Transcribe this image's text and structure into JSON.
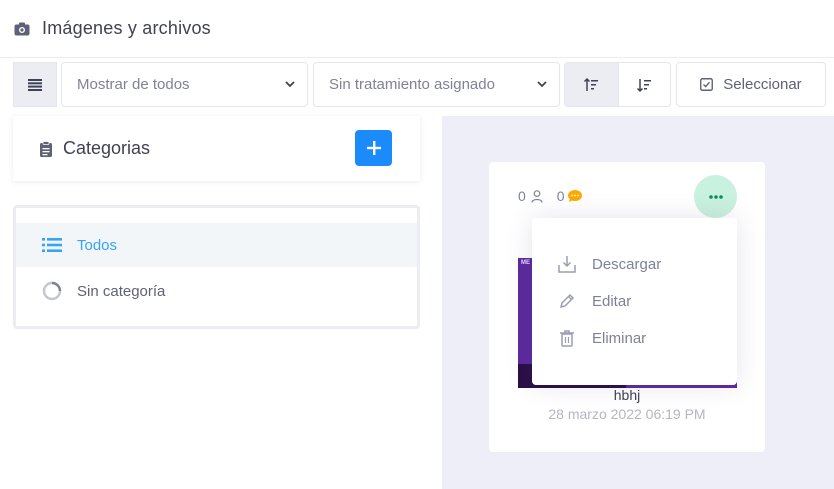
{
  "header": {
    "title": "Imágenes y archivos",
    "icon": "camera-icon"
  },
  "toolbar": {
    "filter_select": "Mostrar de todos",
    "treatment_select": "Sin tratamiento asignado",
    "select_label": "Seleccionar"
  },
  "categories": {
    "title": "Categorias",
    "items": [
      {
        "label": "Todos",
        "active": true,
        "icon": "list-icon"
      },
      {
        "label": "Sin categoría",
        "active": false,
        "icon": "circle-spinner-icon"
      }
    ]
  },
  "file": {
    "users_count": "0",
    "comments_count": "0",
    "name": "hbhj",
    "date": "28 marzo 2022 06:19 PM",
    "thumb_tag": "ME"
  },
  "menu": {
    "items": [
      {
        "label": "Descargar",
        "icon": "download-icon"
      },
      {
        "label": "Editar",
        "icon": "pencil-icon"
      },
      {
        "label": "Eliminar",
        "icon": "trash-icon"
      }
    ]
  },
  "colors": {
    "primary": "#1b8bfb",
    "active_text": "#36a3f7",
    "more_bg": "#c9f1df",
    "comment": "#ffa800"
  }
}
